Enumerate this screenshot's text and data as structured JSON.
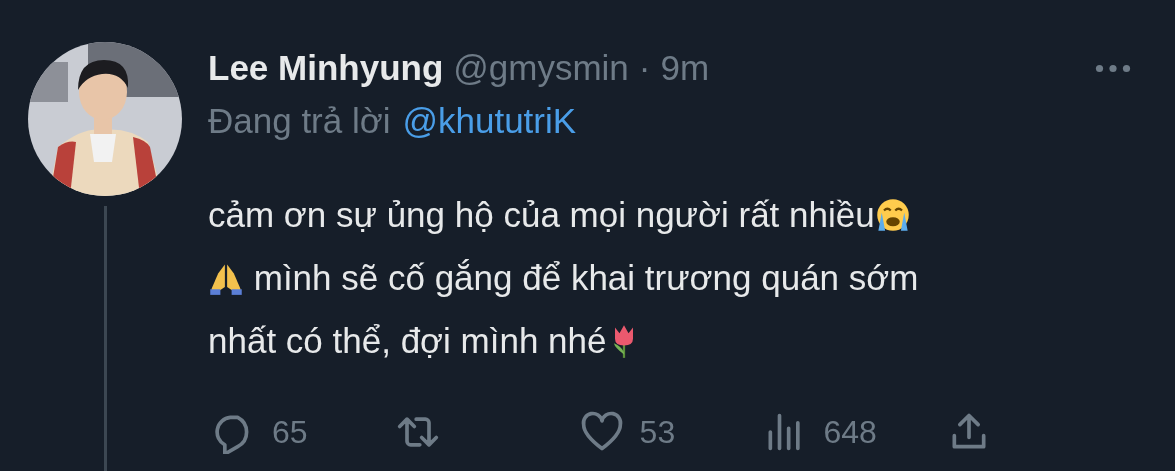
{
  "tweet": {
    "author": {
      "name": "Lee Minhyung",
      "handle": "@gmysmin",
      "separator": "·",
      "time": "9m"
    },
    "reply_to": {
      "label": "Đang trả lời",
      "handle": "@khututriK"
    },
    "lines": [
      [
        {
          "kind": "text",
          "text": "cảm ơn sự ủng hộ của mọi người rất nhiều"
        },
        {
          "kind": "cry"
        }
      ],
      [
        {
          "kind": "pray"
        },
        {
          "kind": "text",
          "text": " mình sẽ cố gắng để khai trương quán sớm"
        }
      ],
      [
        {
          "kind": "text",
          "text": "nhất có thể, đợi mình nhé"
        },
        {
          "kind": "tulip"
        }
      ]
    ],
    "actions": [
      {
        "kind": "reply",
        "count": "65"
      },
      {
        "kind": "retweet"
      },
      {
        "kind": "like",
        "count": "53"
      },
      {
        "kind": "views",
        "count": "648"
      },
      {
        "kind": "share"
      }
    ]
  }
}
